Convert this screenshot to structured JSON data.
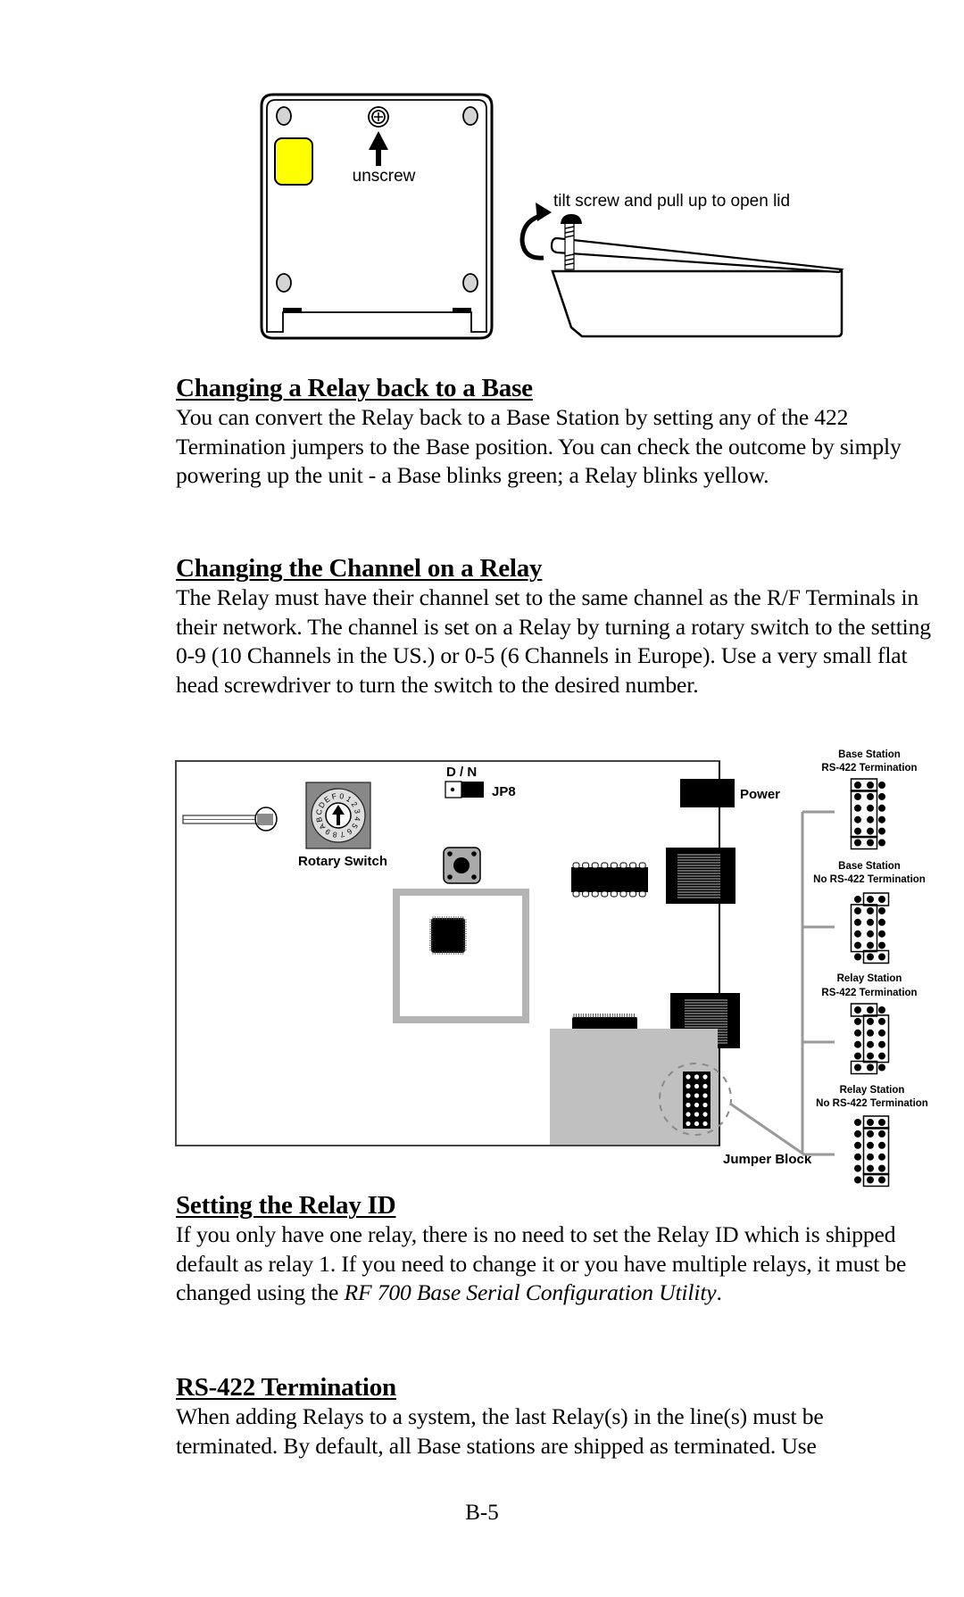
{
  "figure_enclosure": {
    "unscrew_label": "unscrew",
    "tilt_label": "tilt screw and pull up to open lid",
    "icons": [
      "screw-icon",
      "arrow-up-icon",
      "curved-arrow-icon",
      "led-indicator-yellow"
    ],
    "colors": {
      "led": "#ffff00",
      "screw": "#d4d4d4"
    }
  },
  "sections": [
    {
      "heading": "Changing a Relay back to a Base",
      "body": "You can convert the Relay back to a Base Station by setting any of the 422 Termination jumpers to the Base position. You can check the outcome by simply powering up the unit - a Base blinks green; a Relay blinks yellow."
    },
    {
      "heading": "Changing the Channel on a Relay",
      "body": "The Relay must have their channel set to the same channel as the R/F Terminals in their network.  The channel is set on a Relay by turning a rotary switch to the setting 0-9 (10 Channels in the US.) or 0-5 (6 Channels in Europe).   Use a very small flat head screwdriver to turn the switch to the desired number."
    },
    {
      "heading": "Setting the Relay ID",
      "body_before": "If you only have one relay, there is no need to set the Relay ID which is shipped default as relay 1. If you need to change it or you have multiple relays, it must be changed using the ",
      "body_italic": "RF 700 Base Serial Configuration Utility",
      "body_after": "."
    },
    {
      "heading": "RS-422 Termination",
      "body": "When adding Relays to a system, the last Relay(s) in the line(s) must be terminated. By default, all Base stations are shipped as terminated. Use"
    }
  ],
  "figure_board": {
    "dn_label": "D / N",
    "jp8_label": "JP8",
    "power_label": "Power",
    "rotary_label": "Rotary Switch",
    "rotary_digits": "0123456789ABCDEF",
    "jumper_block_label": "Jumper Block",
    "legend": [
      {
        "line1": "Base Station",
        "line2": "RS-422 Termination"
      },
      {
        "line1": "Base Station",
        "line2": "No RS-422 Termination"
      },
      {
        "line1": "Relay Station",
        "line2": "RS-422 Termination"
      },
      {
        "line1": "Relay Station",
        "line2": "No RS-422 Termination"
      }
    ],
    "colors": {
      "board_gray": "#c0c0c0",
      "frame_gray": "#b4b4b4",
      "switch_gray": "#888888",
      "bracket": "#999999"
    }
  },
  "page_number": "B-5"
}
